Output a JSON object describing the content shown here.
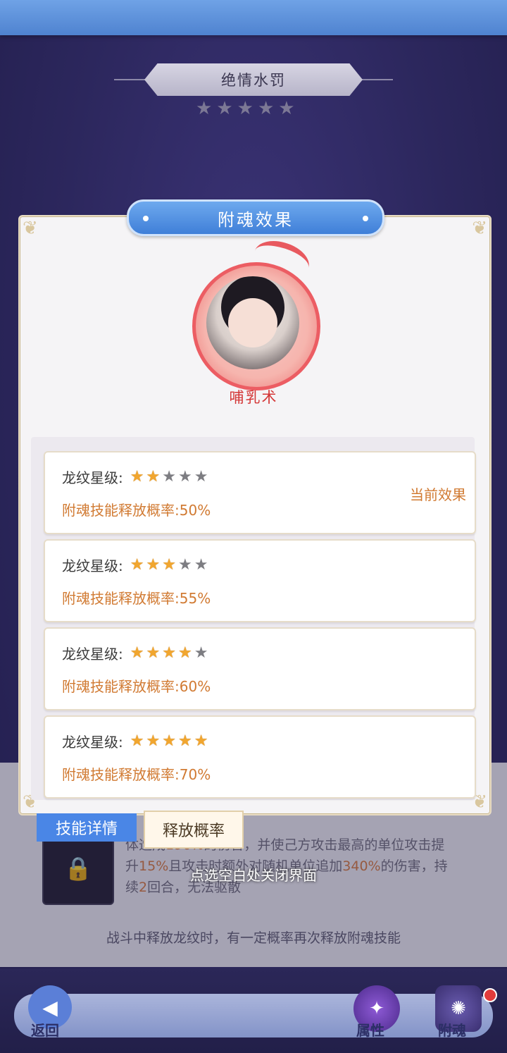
{
  "header": {
    "title": "绝情水罚",
    "star_count": 5
  },
  "modal": {
    "title": "附魂效果",
    "skill_name": "哺乳术",
    "levels": [
      {
        "label": "龙纹星级:",
        "stars_on": 2,
        "stars_total": 5,
        "rate_label": "附魂技能释放概率:",
        "rate": "50%",
        "badge": "当前效果"
      },
      {
        "label": "龙纹星级:",
        "stars_on": 3,
        "stars_total": 5,
        "rate_label": "附魂技能释放概率:",
        "rate": "55%",
        "badge": ""
      },
      {
        "label": "龙纹星级:",
        "stars_on": 4,
        "stars_total": 5,
        "rate_label": "附魂技能释放概率:",
        "rate": "60%",
        "badge": ""
      },
      {
        "label": "龙纹星级:",
        "stars_on": 5,
        "stars_total": 5,
        "rate_label": "附魂技能释放概率:",
        "rate": "70%",
        "badge": ""
      }
    ]
  },
  "tabs": {
    "skill_detail": "技能详情",
    "release_rate": "释放概率"
  },
  "underlying": {
    "desc_pre": "体造成",
    "desc_pct1": "196%",
    "desc_mid1": "的伤害，并使己方攻击最高的单位攻击提升",
    "desc_pct2": "15%",
    "desc_mid2": "且攻击时额外对随机单位追加",
    "desc_pct3": "340%",
    "desc_mid3": "的伤害，持续",
    "desc_num": "2",
    "desc_post": "回合，无法驱散",
    "note": "战斗中释放龙纹时，有一定概率再次释放附魂技能"
  },
  "close_hint": "点选空白处关闭界面",
  "nav": {
    "back": "返回",
    "attributes": "属性",
    "soul": "附魂"
  },
  "colors": {
    "accent_blue": "#4a86e6",
    "rate_orange": "#d17a32",
    "skill_red": "#d43636",
    "star_gold": "#f1a62f"
  }
}
